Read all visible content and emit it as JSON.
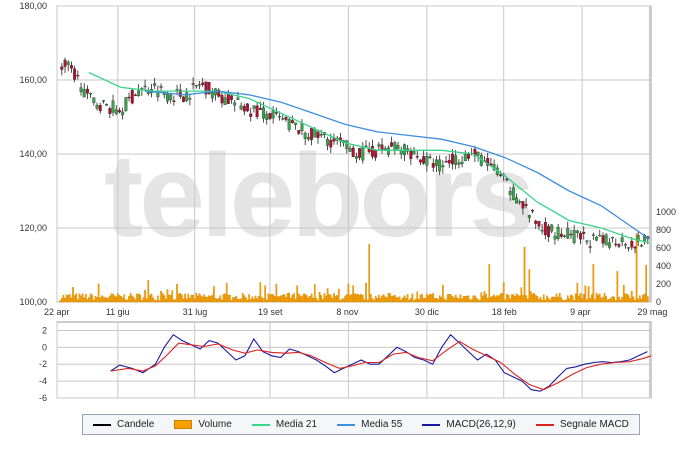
{
  "watermark": "telebors",
  "chart_data": [
    {
      "type": "candlestick",
      "title": "",
      "x_tick_labels": [
        "22 apr",
        "11 giu",
        "31 lug",
        "19 set",
        "8 nov",
        "30 dic",
        "18 feb",
        "9 apr",
        "29 mag"
      ],
      "y_ticks": [
        "100,00",
        "120,00",
        "140,00",
        "160,00",
        "180,00"
      ],
      "ylim": [
        100,
        180
      ],
      "volume_ticks": [
        "0",
        "200",
        "400",
        "600",
        "800",
        "1000"
      ],
      "volume_lim": [
        0,
        1000
      ],
      "grid": true,
      "series": [
        {
          "name": "Candele",
          "color": "#000000",
          "anchors": [
            [
              0,
              162
            ],
            [
              5,
              164
            ],
            [
              12,
              161
            ],
            [
              20,
              155
            ],
            [
              30,
              153
            ],
            [
              40,
              152
            ],
            [
              50,
              157
            ],
            [
              60,
              158
            ],
            [
              70,
              156
            ],
            [
              80,
              156
            ],
            [
              90,
              159
            ],
            [
              100,
              156
            ],
            [
              110,
              154
            ],
            [
              120,
              152
            ],
            [
              130,
              151
            ],
            [
              140,
              149
            ],
            [
              150,
              147
            ],
            [
              160,
              145
            ],
            [
              170,
              144
            ],
            [
              180,
              142
            ],
            [
              190,
              140
            ],
            [
              200,
              141
            ],
            [
              210,
              142
            ],
            [
              220,
              141
            ],
            [
              230,
              138
            ],
            [
              240,
              137
            ],
            [
              250,
              139
            ],
            [
              260,
              140
            ],
            [
              270,
              137
            ],
            [
              275,
              135
            ],
            [
              280,
              132
            ],
            [
              290,
              127
            ],
            [
              300,
              121
            ],
            [
              310,
              119
            ],
            [
              320,
              118
            ],
            [
              330,
              117
            ],
            [
              340,
              116
            ],
            [
              350,
              117
            ],
            [
              360,
              116
            ],
            [
              370,
              117
            ]
          ]
        },
        {
          "name": "Media 21",
          "color": "#38d68b",
          "values": [
            [
              20,
              162
            ],
            [
              40,
              158
            ],
            [
              60,
              157
            ],
            [
              80,
              157
            ],
            [
              100,
              157
            ],
            [
              120,
              155
            ],
            [
              140,
              151
            ],
            [
              160,
              147
            ],
            [
              180,
              143
            ],
            [
              200,
              141
            ],
            [
              220,
              141
            ],
            [
              240,
              141
            ],
            [
              260,
              140
            ],
            [
              280,
              134
            ],
            [
              300,
              127
            ],
            [
              320,
              122
            ],
            [
              340,
              120
            ],
            [
              360,
              117
            ],
            [
              370,
              116
            ]
          ]
        },
        {
          "name": "Media 55",
          "color": "#3e8fe0",
          "values": [
            [
              55,
              157
            ],
            [
              80,
              156
            ],
            [
              100,
              157
            ],
            [
              120,
              156
            ],
            [
              140,
              154
            ],
            [
              160,
              151
            ],
            [
              180,
              148
            ],
            [
              200,
              146
            ],
            [
              220,
              145
            ],
            [
              240,
              144
            ],
            [
              260,
              142
            ],
            [
              280,
              139
            ],
            [
              300,
              135
            ],
            [
              320,
              130
            ],
            [
              340,
              126
            ],
            [
              360,
              120
            ],
            [
              370,
              117
            ]
          ]
        }
      ]
    },
    {
      "type": "bar",
      "title": "",
      "series": [
        {
          "name": "Volume",
          "color": "#f9a100",
          "spikes": [
            [
              55,
              130
            ],
            [
              57,
              240
            ],
            [
              65,
              120
            ],
            [
              70,
              80
            ],
            [
              130,
              180
            ],
            [
              137,
              200
            ],
            [
              195,
              640
            ],
            [
              270,
              420
            ],
            [
              292,
              610
            ],
            [
              295,
              360
            ],
            [
              335,
              420
            ],
            [
              350,
              340
            ],
            [
              362,
              760
            ],
            [
              368,
              410
            ]
          ],
          "base_level": 55
        }
      ]
    },
    {
      "type": "line",
      "title": "",
      "y_ticks": [
        "-6",
        "-4",
        "-2",
        "0",
        "2"
      ],
      "ylim": [
        -6,
        3
      ],
      "series": [
        {
          "name": "MACD(26,12,9)",
          "color": "#1a1aa0",
          "values": [
            [
              30,
              -2.8
            ],
            [
              35,
              -2.1
            ],
            [
              42,
              -2.5
            ],
            [
              48,
              -3.0
            ],
            [
              55,
              -2.0
            ],
            [
              60,
              0.0
            ],
            [
              65,
              1.5
            ],
            [
              70,
              0.8
            ],
            [
              75,
              0.3
            ],
            [
              80,
              -0.2
            ],
            [
              85,
              0.8
            ],
            [
              90,
              0.5
            ],
            [
              95,
              -0.5
            ],
            [
              100,
              -1.5
            ],
            [
              105,
              -1.0
            ],
            [
              110,
              1.0
            ],
            [
              115,
              -0.5
            ],
            [
              120,
              -1.0
            ],
            [
              125,
              -1.2
            ],
            [
              130,
              -0.2
            ],
            [
              135,
              -0.5
            ],
            [
              140,
              -1.0
            ],
            [
              145,
              -1.5
            ],
            [
              150,
              -2.2
            ],
            [
              155,
              -3.0
            ],
            [
              160,
              -2.5
            ],
            [
              165,
              -2.0
            ],
            [
              170,
              -1.5
            ],
            [
              175,
              -2.0
            ],
            [
              180,
              -2.0
            ],
            [
              185,
              -1.0
            ],
            [
              190,
              0.0
            ],
            [
              195,
              -0.5
            ],
            [
              200,
              -1.2
            ],
            [
              205,
              -1.5
            ],
            [
              210,
              -2.0
            ],
            [
              215,
              0.0
            ],
            [
              220,
              1.5
            ],
            [
              225,
              0.5
            ],
            [
              230,
              -0.5
            ],
            [
              235,
              -1.5
            ],
            [
              240,
              -0.8
            ],
            [
              245,
              -1.5
            ],
            [
              250,
              -3.0
            ],
            [
              255,
              -3.5
            ],
            [
              260,
              -4.0
            ],
            [
              265,
              -5.0
            ],
            [
              270,
              -5.2
            ],
            [
              275,
              -4.6
            ],
            [
              280,
              -3.5
            ],
            [
              285,
              -2.5
            ],
            [
              290,
              -2.3
            ],
            [
              295,
              -2.0
            ],
            [
              300,
              -1.8
            ],
            [
              305,
              -1.7
            ],
            [
              310,
              -1.8
            ],
            [
              315,
              -1.7
            ],
            [
              320,
              -1.5
            ],
            [
              325,
              -1.0
            ],
            [
              330,
              -0.5
            ]
          ]
        },
        {
          "name": "Segnale MACD",
          "color": "#dd2020",
          "values": [
            [
              30,
              -2.8
            ],
            [
              40,
              -2.5
            ],
            [
              48,
              -2.8
            ],
            [
              55,
              -2.2
            ],
            [
              62,
              -0.8
            ],
            [
              68,
              0.5
            ],
            [
              75,
              0.3
            ],
            [
              82,
              0.1
            ],
            [
              90,
              0.4
            ],
            [
              98,
              -0.3
            ],
            [
              105,
              -0.7
            ],
            [
              112,
              -0.3
            ],
            [
              120,
              -0.6
            ],
            [
              128,
              -0.7
            ],
            [
              135,
              -0.6
            ],
            [
              142,
              -1.0
            ],
            [
              150,
              -1.8
            ],
            [
              158,
              -2.5
            ],
            [
              165,
              -2.2
            ],
            [
              172,
              -1.8
            ],
            [
              180,
              -1.8
            ],
            [
              188,
              -0.8
            ],
            [
              195,
              -0.6
            ],
            [
              202,
              -1.2
            ],
            [
              210,
              -1.6
            ],
            [
              218,
              -0.3
            ],
            [
              225,
              0.7
            ],
            [
              232,
              -0.2
            ],
            [
              240,
              -1.0
            ],
            [
              248,
              -1.8
            ],
            [
              256,
              -3.2
            ],
            [
              264,
              -4.4
            ],
            [
              272,
              -5.0
            ],
            [
              280,
              -4.2
            ],
            [
              288,
              -3.2
            ],
            [
              296,
              -2.4
            ],
            [
              304,
              -2.0
            ],
            [
              312,
              -1.8
            ],
            [
              320,
              -1.7
            ],
            [
              328,
              -1.3
            ],
            [
              332,
              -1.0
            ]
          ]
        }
      ]
    }
  ],
  "legend": [
    {
      "label": "Candele",
      "color": "#000000",
      "kind": "line"
    },
    {
      "label": "Volume",
      "color": "#f9a100",
      "kind": "box"
    },
    {
      "label": "Media 21",
      "color": "#38d68b",
      "kind": "line"
    },
    {
      "label": "Media 55",
      "color": "#3e8fe0",
      "kind": "line"
    },
    {
      "label": "MACD(26,12,9)",
      "color": "#1a1aa0",
      "kind": "line"
    },
    {
      "label": "Segnale MACD",
      "color": "#dd2020",
      "kind": "line"
    }
  ]
}
